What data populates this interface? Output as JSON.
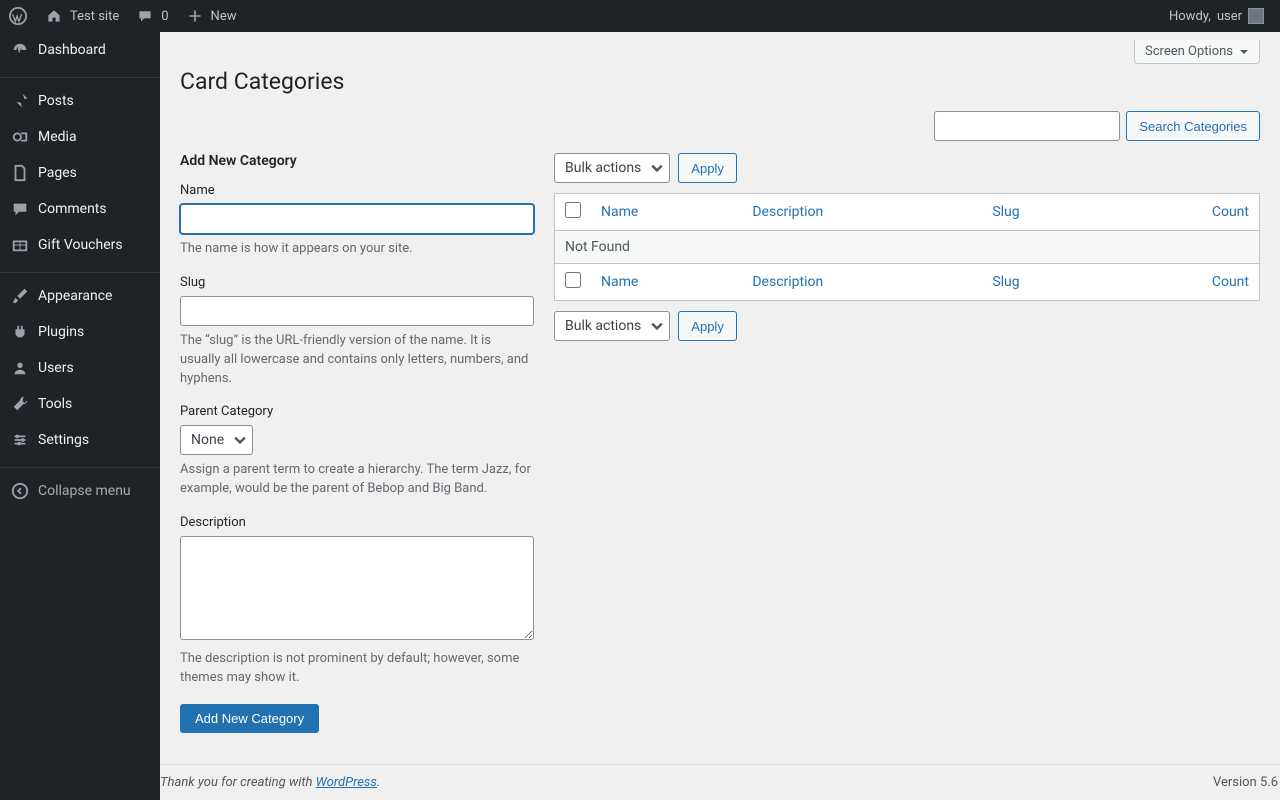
{
  "adminbar": {
    "site_name": "Test site",
    "comments_count": "0",
    "new_label": "New",
    "howdy_prefix": "Howdy, ",
    "user_name": "user"
  },
  "sidebar": {
    "items": [
      {
        "id": "dashboard",
        "label": "Dashboard",
        "icon": "dashboard"
      },
      {
        "id": "posts",
        "label": "Posts",
        "icon": "pin"
      },
      {
        "id": "media",
        "label": "Media",
        "icon": "media"
      },
      {
        "id": "pages",
        "label": "Pages",
        "icon": "page"
      },
      {
        "id": "comments",
        "label": "Comments",
        "icon": "comment"
      },
      {
        "id": "gift_vouchers",
        "label": "Gift Vouchers",
        "icon": "voucher"
      },
      {
        "id": "appearance",
        "label": "Appearance",
        "icon": "brush"
      },
      {
        "id": "plugins",
        "label": "Plugins",
        "icon": "plugin"
      },
      {
        "id": "users",
        "label": "Users",
        "icon": "user"
      },
      {
        "id": "tools",
        "label": "Tools",
        "icon": "tool"
      },
      {
        "id": "settings",
        "label": "Settings",
        "icon": "settings"
      }
    ],
    "collapse_label": "Collapse menu"
  },
  "screen_options_label": "Screen Options",
  "page_title": "Card Categories",
  "search": {
    "button": "Search Categories"
  },
  "form": {
    "heading": "Add New Category",
    "name_label": "Name",
    "name_help": "The name is how it appears on your site.",
    "slug_label": "Slug",
    "slug_help": "The “slug” is the URL-friendly version of the name. It is usually all lowercase and contains only letters, numbers, and hyphens.",
    "parent_label": "Parent Category",
    "parent_selected": "None",
    "parent_help": "Assign a parent term to create a hierarchy. The term Jazz, for example, would be the parent of Bebop and Big Band.",
    "description_label": "Description",
    "description_help": "The description is not prominent by default; however, some themes may show it.",
    "submit_label": "Add New Category"
  },
  "table": {
    "bulk_actions_label": "Bulk actions",
    "apply_label": "Apply",
    "columns": {
      "name": "Name",
      "description": "Description",
      "slug": "Slug",
      "count": "Count"
    },
    "not_found": "Not Found"
  },
  "footer": {
    "thanks_prefix": "Thank you for creating with ",
    "link_text": "WordPress",
    "period": ".",
    "version": "Version 5.6"
  }
}
